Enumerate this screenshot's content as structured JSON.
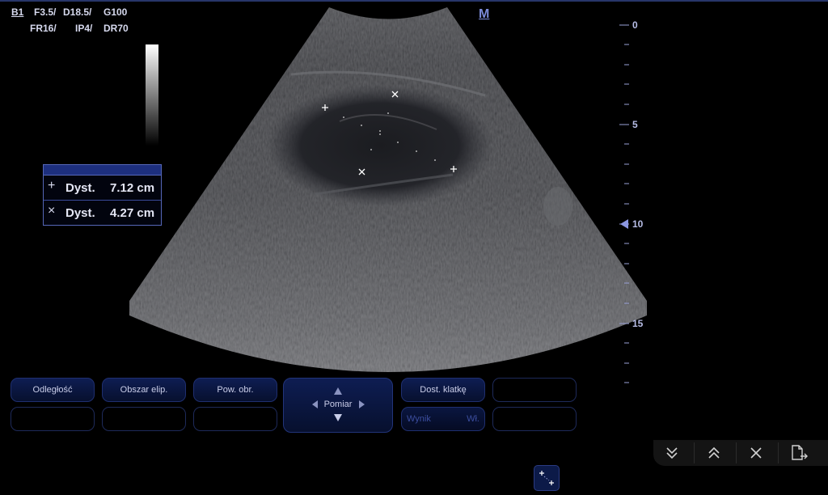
{
  "header": {
    "probe": "B1",
    "freq": "F3.5/",
    "depth": "D18.5/",
    "gain": "G100",
    "frame_rate": "FR16/",
    "image_processing": "IP4/",
    "dynamic_range": "DR70",
    "mode": "M"
  },
  "measurements": [
    {
      "marker": "+",
      "label": "Dyst.",
      "value": "7.12 cm"
    },
    {
      "marker": "×",
      "label": "Dyst.",
      "value": "4.27 cm"
    }
  ],
  "depth_scale": {
    "labels": [
      "0",
      "5",
      "10",
      "15"
    ],
    "focus_depth": 10
  },
  "softkeys": {
    "odleglosc": "Odległość",
    "obszar_elip": "Obszar elip.",
    "pow_obr": "Pow. obr.",
    "pomiar": "Pomiar",
    "dost_klatke": "Dost. klatkę",
    "wynik": "Wynik",
    "wl": "Wł."
  },
  "nav_icons": [
    "double-chevron-down-icon",
    "double-chevron-up-icon",
    "close-icon",
    "export-file-icon"
  ],
  "colors": {
    "accent": "#5567b8",
    "mode_label": "#7b8ad8",
    "button_bg": "#0e1d52"
  }
}
